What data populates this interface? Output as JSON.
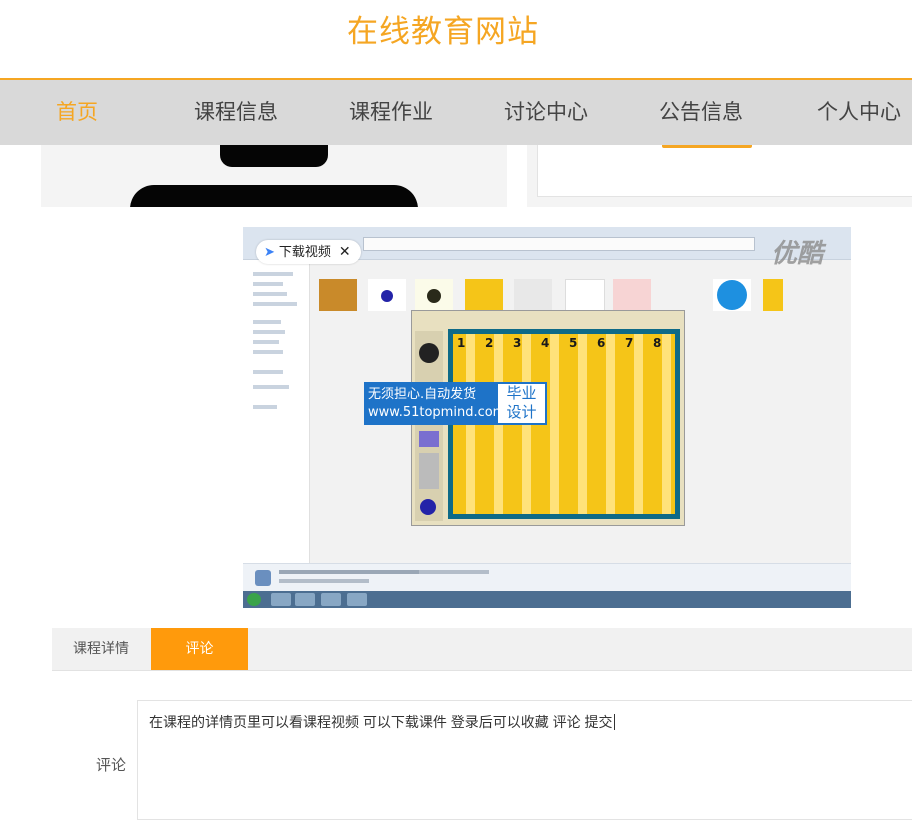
{
  "site": {
    "title": "在线教育网站"
  },
  "nav": {
    "items": [
      {
        "label": "首页",
        "active": true
      },
      {
        "label": "课程信息"
      },
      {
        "label": "课程作业"
      },
      {
        "label": "讨论中心"
      },
      {
        "label": "公告信息"
      },
      {
        "label": "个人中心"
      }
    ]
  },
  "video": {
    "download_label": "下载视频",
    "close_symbol": "✕",
    "watermark": "优酷",
    "ad_line1": "无须担心.自动发货",
    "ad_line2": "www.51topmind.com",
    "ad_badge_line1": "毕业",
    "ad_badge_line2": "设计",
    "lane_numbers": [
      "1",
      "2",
      "3",
      "4",
      "5",
      "6",
      "7",
      "8"
    ]
  },
  "tabs": [
    {
      "label": "课程详情",
      "active": false
    },
    {
      "label": "评论",
      "active": true
    }
  ],
  "comment": {
    "label": "评论",
    "value": "在课程的详情页里可以看课程视频 可以下载课件   登录后可以收藏 评论  提交"
  },
  "colors": {
    "accent": "#f5a623",
    "tab_active": "#ff9a0c",
    "nav_bg": "#d9d9d9"
  }
}
